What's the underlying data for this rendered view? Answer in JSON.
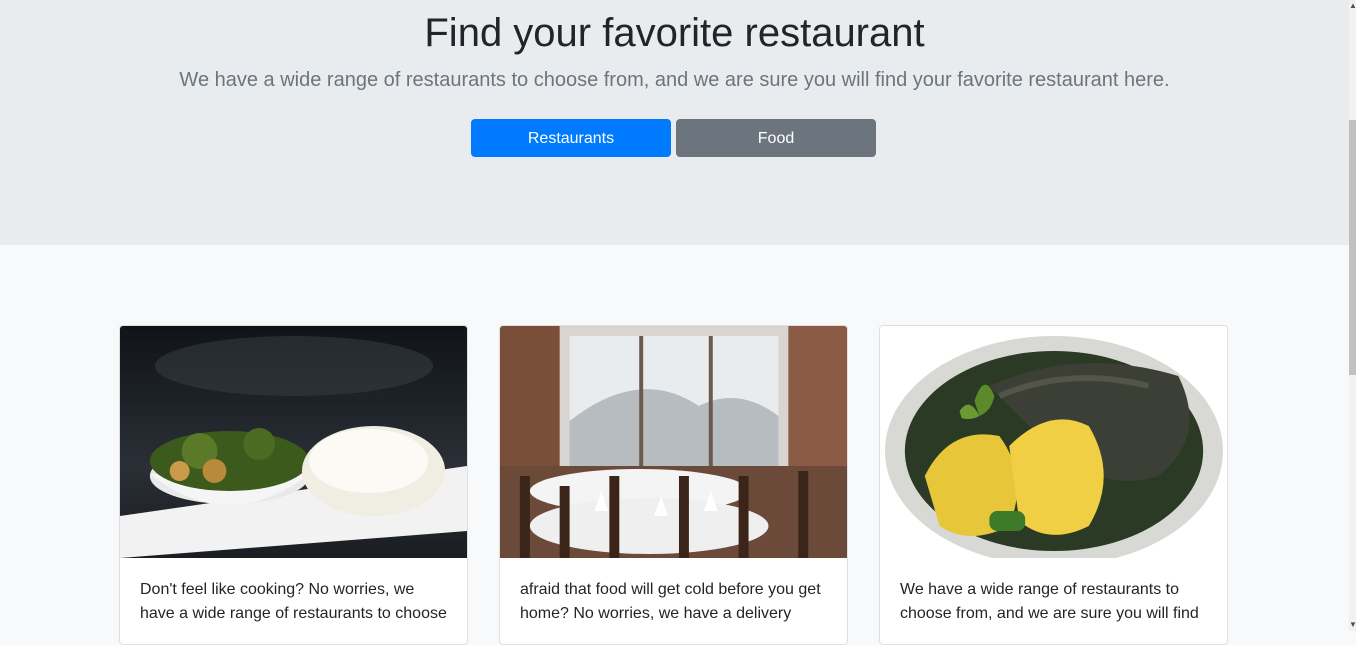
{
  "hero": {
    "title": "Find your favorite restaurant",
    "lead": "We have a wide range of restaurants to choose from, and we are sure you will find your favorite restaurant here.",
    "buttons": [
      {
        "label": "Restaurants"
      },
      {
        "label": "Food"
      }
    ]
  },
  "cards": [
    {
      "text": "Don't feel like cooking? No worries, we have a wide range of restaurants to choose",
      "image": "food-plate-photo"
    },
    {
      "text": "afraid that food will get cold before you get home? No worries, we have a delivery",
      "image": "restaurant-interior-photo"
    },
    {
      "text": "We have a wide range of restaurants to choose from, and we are sure you will find",
      "image": "soup-dish-photo"
    }
  ],
  "colors": {
    "primary": "#007bff",
    "secondary": "#6c757d",
    "hero_bg": "#e9ecef"
  }
}
